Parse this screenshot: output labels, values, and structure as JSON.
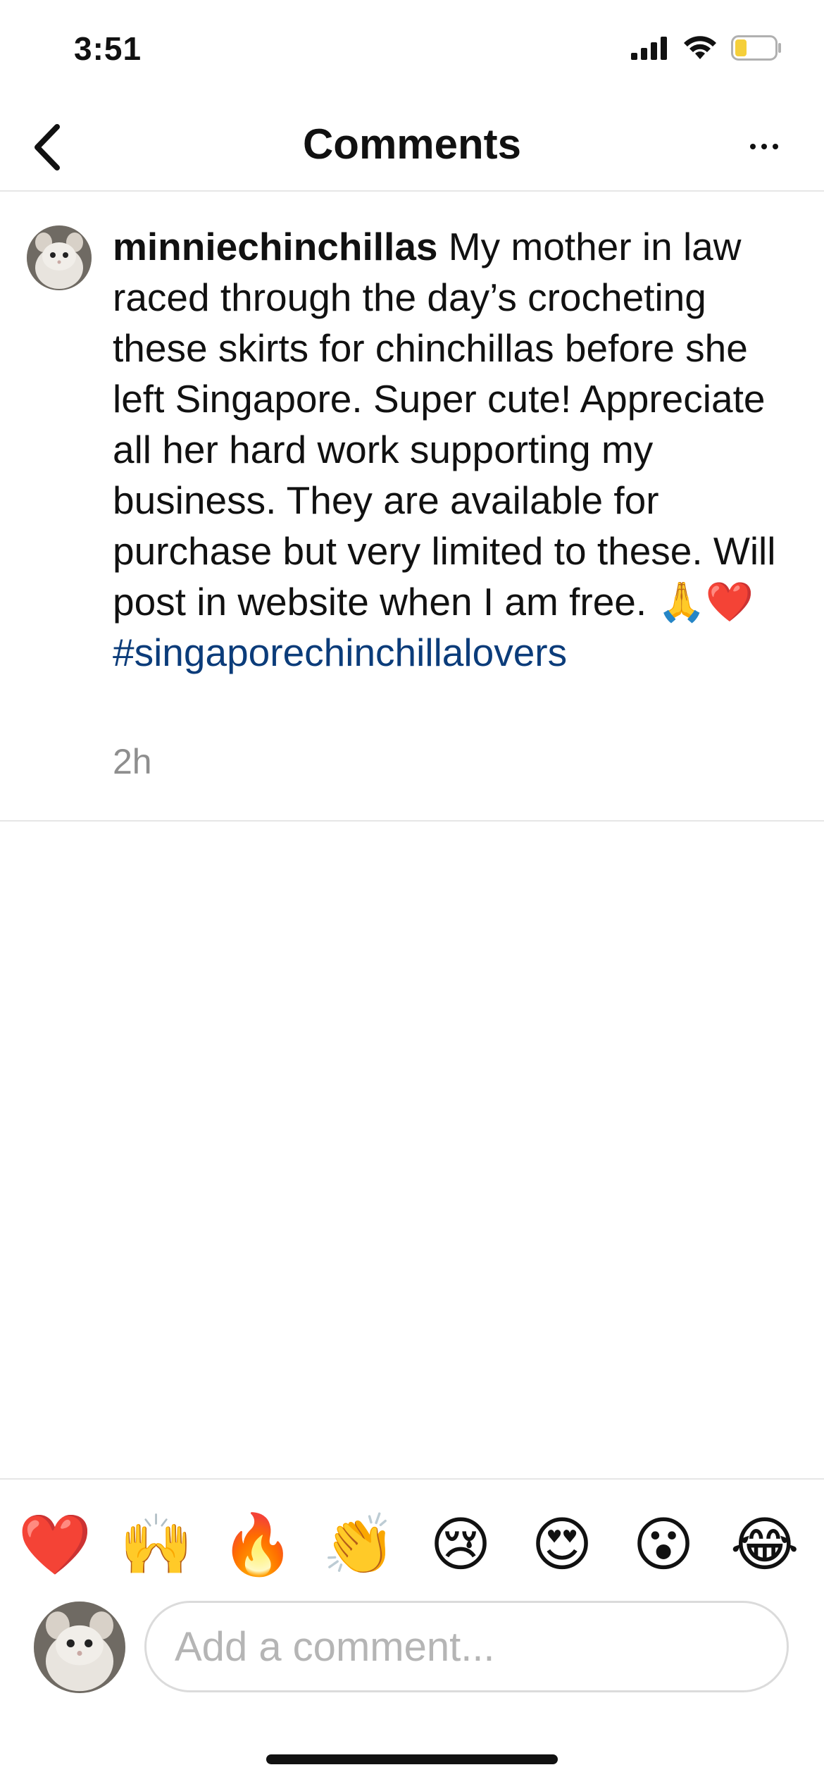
{
  "status_bar": {
    "time": "3:51",
    "icons": [
      "cellular-signal-icon",
      "wifi-icon",
      "battery-low-icon"
    ]
  },
  "nav": {
    "title": "Comments",
    "back_icon": "chevron-left-icon",
    "more_icon": "more-horizontal-icon"
  },
  "comment": {
    "username": "minniechinchillas",
    "text": "My mother in law raced through the day’s crocheting these skirts for chinchillas before she left Singapore. Super cute! Appreciate all her hard work supporting my business. They are available for purchase but very limited to these. Will post in website when I am free.",
    "emojis": "🙏❤️",
    "hashtag": "#singaporechinchillalovers",
    "timestamp": "2h"
  },
  "reactions": [
    "❤️",
    "🙌",
    "🔥",
    "👏",
    "😢",
    "😍",
    "😮",
    "😂"
  ],
  "composer": {
    "placeholder": "Add a comment..."
  },
  "colors": {
    "hashtag": "#0b3c7a",
    "muted": "#8e8e8e",
    "divider": "#e6e6e6",
    "battery_fill": "#f5cf3a"
  }
}
